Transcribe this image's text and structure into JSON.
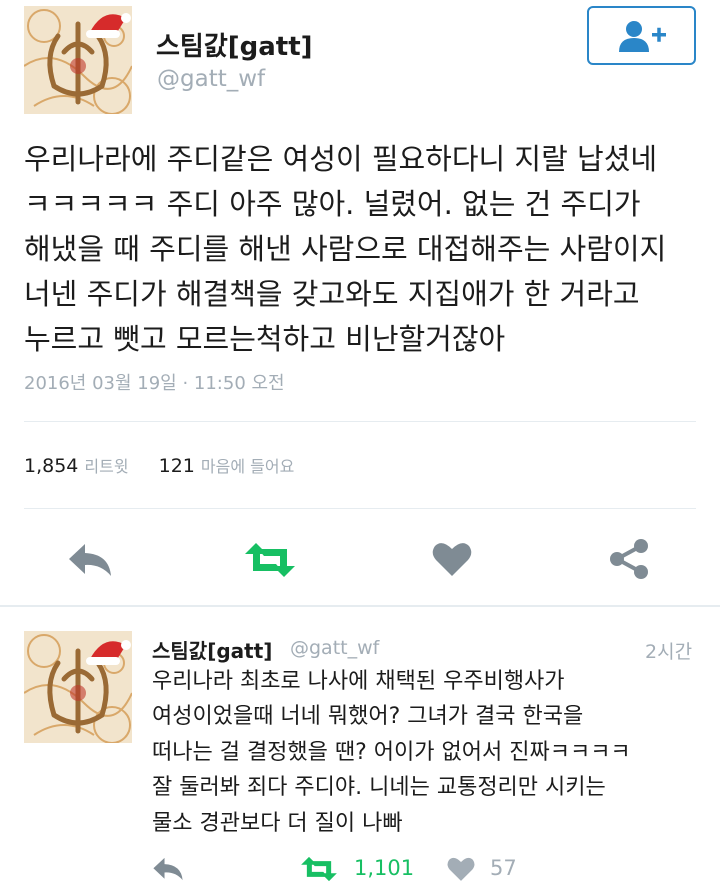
{
  "main_tweet": {
    "display_name": "스팀갌[gatt]",
    "handle": "@gatt_wf",
    "follow_icon": "add-user-icon",
    "text_lines": [
      "우리나라에 주디같은 여성이 필요하다니 지랄 납셨네",
      "ㅋㅋㅋㅋㅋ 주디 아주 많아. 널렸어. 없는 건 주디가",
      "해냈을 때 주디를 해낸 사람으로 대접해주는 사람이지",
      "너넨 주디가 해결책을 갖고와도 지집애가 한 거라고",
      "누르고 뺏고 모르는척하고 비난할거잖아"
    ],
    "timestamp": "2016년 03월 19일 · 11:50 오전",
    "retweets_count": "1,854",
    "retweets_label": "리트윗",
    "likes_count": "121",
    "likes_label": "마음에 들어요"
  },
  "actions": {
    "reply_icon": "reply-icon",
    "retweet_icon": "retweet-icon",
    "like_icon": "heart-icon",
    "share_icon": "share-icon"
  },
  "reply_tweet": {
    "display_name": "스팀갌[gatt]",
    "handle": "@gatt_wf",
    "time": "2시간",
    "text_lines": [
      "우리나라 최초로 나사에 채택된 우주비행사가",
      "여성이었을때 너네 뭐했어? 그녀가 결국 한국을",
      "떠나는 걸 결정했을 땐? 어이가 없어서 진짜ㅋㅋㅋㅋ",
      "잘 둘러봐 죄다 주디야. 니네는 교통정리만 시키는",
      "물소 경관보다 더 질이 나빠"
    ],
    "retweet_count": "1,101",
    "like_count": "57"
  },
  "colors": {
    "accent_blue": "#2a86c8",
    "retweet_green": "#17bf63",
    "icon_gray": "#7f8b94",
    "muted_text": "#a3adb6",
    "divider": "#e6ecf0"
  }
}
